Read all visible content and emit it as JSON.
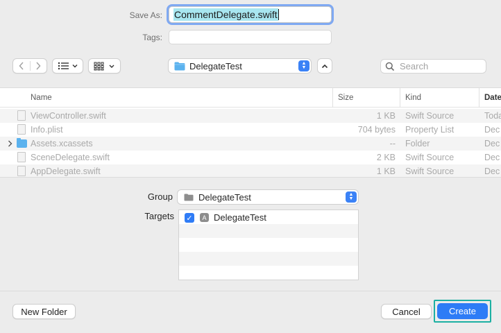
{
  "save_as": {
    "label": "Save As:",
    "value": "CommentDelegate.swift"
  },
  "tags": {
    "label": "Tags:",
    "value": ""
  },
  "toolbar": {
    "back_icon": "chevron-left-icon",
    "forward_icon": "chevron-right-icon",
    "list_view_icon": "list-icon",
    "grid_view_icon": "grid-icon",
    "location": "DelegateTest",
    "search_placeholder": "Search"
  },
  "file_list": {
    "columns": [
      "Name",
      "Size",
      "Kind",
      "Date"
    ],
    "rows": [
      {
        "name": "ViewController.swift",
        "size": "1 KB",
        "kind": "Swift Source",
        "date": "Toda",
        "icon": "document-icon"
      },
      {
        "name": "Info.plist",
        "size": "704 bytes",
        "kind": "Property List",
        "date": "Dec",
        "icon": "document-icon"
      },
      {
        "name": "Assets.xcassets",
        "size": "--",
        "kind": "Folder",
        "date": "Dec",
        "icon": "folder-icon"
      },
      {
        "name": "SceneDelegate.swift",
        "size": "2 KB",
        "kind": "Swift Source",
        "date": "Dec",
        "icon": "document-icon"
      },
      {
        "name": "AppDelegate.swift",
        "size": "1 KB",
        "kind": "Swift Source",
        "date": "Dec",
        "icon": "document-icon"
      }
    ]
  },
  "group": {
    "label": "Group",
    "value": "DelegateTest"
  },
  "targets": {
    "label": "Targets",
    "items": [
      {
        "name": "DelegateTest",
        "checked": true
      }
    ]
  },
  "buttons": {
    "new_folder": "New Folder",
    "cancel": "Cancel",
    "create": "Create"
  },
  "colors": {
    "accent": "#2e7cf6",
    "highlight_frame": "#1cb0a2",
    "folder": "#5bb2ee"
  }
}
